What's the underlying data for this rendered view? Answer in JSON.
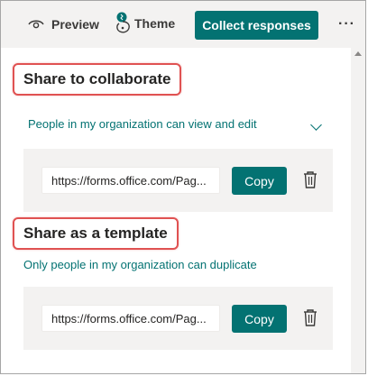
{
  "toolbar": {
    "preview_label": "Preview",
    "theme_label": "Theme",
    "collect_label": "Collect responses",
    "more_label": "···"
  },
  "collaborate": {
    "title": "Share to collaborate",
    "permission": "People in my organization can view and edit",
    "link": "https://forms.office.com/Pag...",
    "copy_label": "Copy"
  },
  "template": {
    "title": "Share as a template",
    "permission": "Only people in my organization can duplicate",
    "link": "https://forms.office.com/Pag...",
    "copy_label": "Copy"
  },
  "colors": {
    "accent": "#037272",
    "highlight_border": "#e05252",
    "toolbar_bg": "#f3f2f1"
  },
  "icons": [
    "eye-icon",
    "palette-icon",
    "more-icon",
    "chevron-down-icon",
    "trash-icon",
    "scroll-up-icon"
  ]
}
